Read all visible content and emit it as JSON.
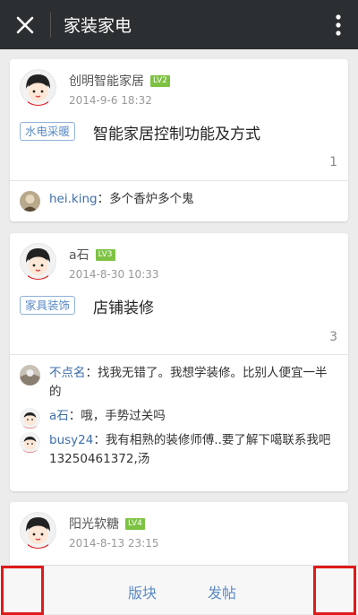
{
  "header": {
    "title": "家装家电",
    "close_icon": "close-icon",
    "more_icon": "more-vertical-icon"
  },
  "posts": [
    {
      "author": "创明智能家居",
      "level": "LV2",
      "time": "2014-9-6 18:32",
      "tag": "水电采暖",
      "title": "智能家居控制功能及方式",
      "count": "1",
      "comments": [
        {
          "user": "hei.king",
          "text": "：多个香炉多个鬼"
        }
      ]
    },
    {
      "author": "a石",
      "level": "LV3",
      "time": "2014-8-30 10:33",
      "tag": "家具装饰",
      "title": "店铺装修",
      "count": "3",
      "comments": [
        {
          "user": "不点名",
          "text": "：找我无错了。我想学装修。比别人便宜一半的"
        },
        {
          "user": "a石",
          "text": "：哦，手势过关吗"
        },
        {
          "user": "busy24",
          "text": "：我有相熟的装修师傅..要了解下噶联系我吧13250461372,汤"
        }
      ]
    },
    {
      "author": "阳光软糖",
      "level": "LV4",
      "time": "2014-8-13 23:15"
    }
  ],
  "bottom_bar": {
    "section_label": "版块",
    "post_label": "发帖"
  },
  "colors": {
    "topbar": "#2b2f31",
    "accent": "#5b8bc4",
    "level_badge": "#7dc242",
    "highlight_box": "#e01a1a"
  }
}
